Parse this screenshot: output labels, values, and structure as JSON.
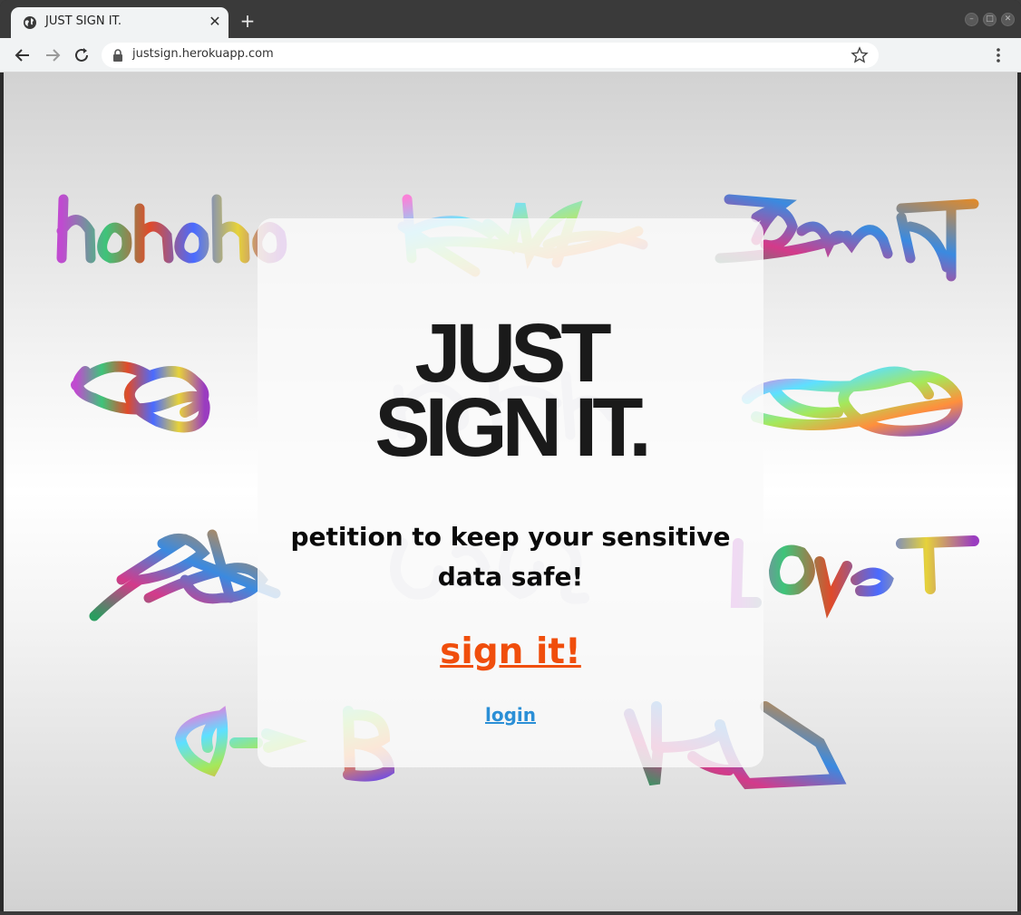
{
  "browser": {
    "tab_title": "JUST SIGN IT.",
    "tab_close": "✕",
    "new_tab": "+",
    "url": "justsign.herokuapp.com",
    "window_buttons": [
      "–",
      "□",
      "✕"
    ]
  },
  "page": {
    "headline_line1": "JUST",
    "headline_line2": "SIGN IT.",
    "tagline": "petition to keep your sensitive data safe!",
    "sign_link": "sign it!",
    "login_link": "login"
  },
  "colors": {
    "accent_link": "#f04e0c",
    "login_link": "#2b8fd6",
    "headline": "#1a1a1a"
  },
  "icons": [
    "globe-icon",
    "close-icon",
    "plus-icon",
    "back-arrow-icon",
    "forward-arrow-icon",
    "reload-icon",
    "lock-icon",
    "star-icon",
    "kebab-menu-icon"
  ]
}
